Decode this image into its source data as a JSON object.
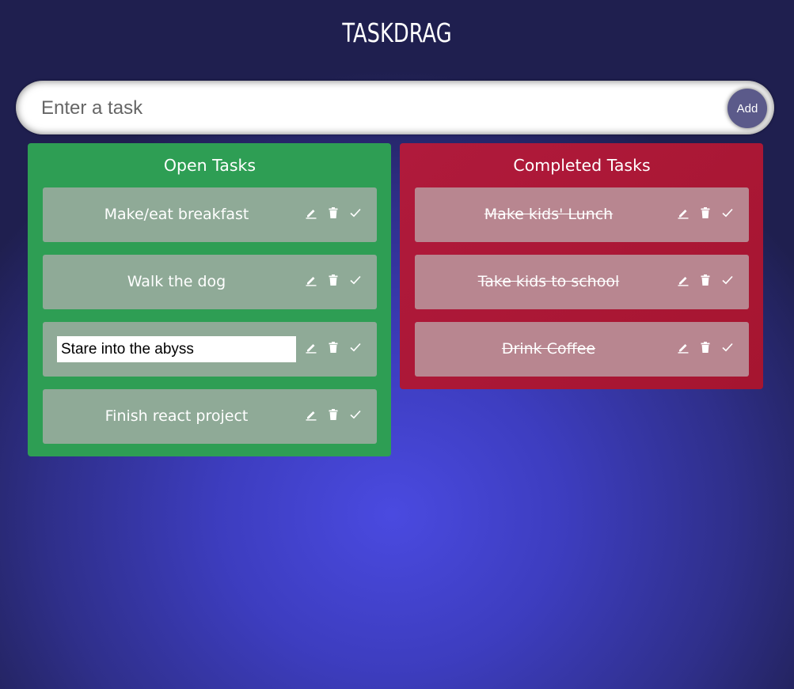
{
  "app": {
    "title": "TASKDRAG"
  },
  "new_task": {
    "placeholder": "Enter a task",
    "add_label": "Add"
  },
  "open_column": {
    "title": "Open Tasks",
    "tasks": [
      {
        "text": "Make/eat breakfast",
        "editing": false
      },
      {
        "text": "Walk the dog",
        "editing": false
      },
      {
        "text": "Stare into the abyss",
        "editing": true
      },
      {
        "text": "Finish react project",
        "editing": false
      }
    ]
  },
  "completed_column": {
    "title": "Completed Tasks",
    "tasks": [
      {
        "text": "Make kids' Lunch"
      },
      {
        "text": "Take kids to school"
      },
      {
        "text": "Drink Coffee"
      }
    ]
  },
  "icons": [
    "pencil-icon",
    "trash-icon",
    "check-icon"
  ],
  "colors": {
    "open_column": "#2e9e54",
    "completed_column": "#a8173a",
    "open_card": "#8faa97",
    "completed_card": "#b88690",
    "add_button": "#5b5a8a"
  }
}
